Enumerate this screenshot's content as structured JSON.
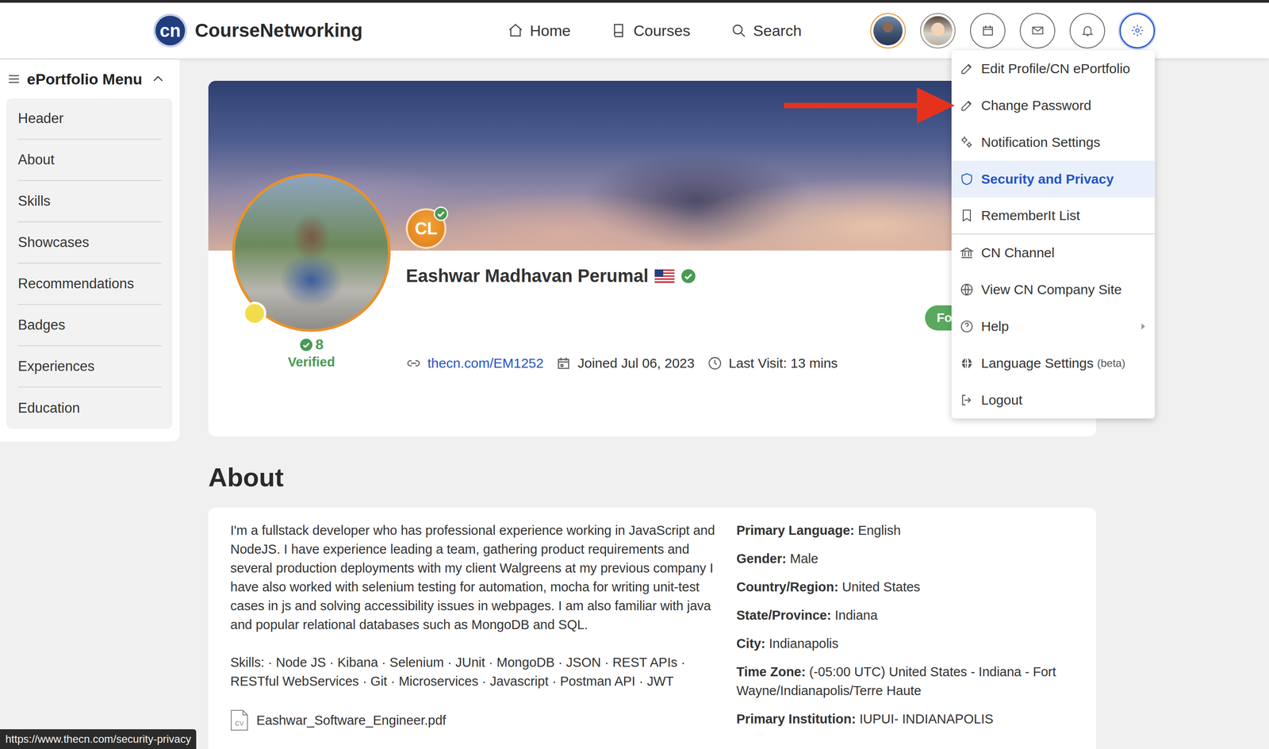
{
  "logo": {
    "mark": "cn",
    "name": "CourseNetworking"
  },
  "nav": [
    {
      "label": "Home",
      "selected": false
    },
    {
      "label": "Courses",
      "selected": false
    },
    {
      "label": "Search",
      "selected": false
    }
  ],
  "toolbar": [
    {
      "kind": "avatar",
      "selected": false,
      "color": "#e8912d"
    },
    {
      "kind": "avatar",
      "selected": false,
      "color": "#8a8a8a"
    },
    {
      "kind": "icon",
      "selected": false,
      "color": "#6b6b6b"
    },
    {
      "kind": "icon",
      "selected": false,
      "color": "#6b6b6b"
    },
    {
      "kind": "icon",
      "selected": false,
      "color": "#6b6b6b"
    },
    {
      "kind": "icon",
      "selected": true,
      "color": "#2d5bd1"
    }
  ],
  "sidebar": {
    "title": "ePortfolio Menu",
    "expanded": true,
    "items": [
      {
        "label": "Header",
        "selected": false
      },
      {
        "label": "About",
        "selected": false
      },
      {
        "label": "Skills",
        "selected": false
      },
      {
        "label": "Showcases",
        "selected": false
      },
      {
        "label": "Recommendations",
        "selected": false
      },
      {
        "label": "Badges",
        "selected": false
      },
      {
        "label": "Experiences",
        "selected": false
      },
      {
        "label": "Education",
        "selected": false
      }
    ]
  },
  "profile": {
    "name": "Eashwar Madhavan Perumal",
    "verified": true,
    "online": true,
    "badge": "CL",
    "badge_verified": true,
    "verified_count": "8",
    "verified_label": "Verified",
    "link": "thecn.com/EM1252",
    "joined": "Joined Jul 06, 2023",
    "last_visit": "Last Visit: 13 mins",
    "follow_button": "Fo"
  },
  "about": {
    "heading": "About",
    "bio": "I'm a fullstack developer who has professional experience working in JavaScript and NodeJS. I have experience leading a team, gathering product requirements and several production deployments with my client Walgreens at my previous company I have also worked with selenium testing for automation, mocha for writing unit-test cases in js and solving accessibility issues in webpages. I am also familiar with java and popular relational databases such as MongoDB and SQL.",
    "skills": "Skills: · Node JS · Kibana · Selenium · JUnit · MongoDB · JSON · REST APIs · RESTful WebServices · Git · Microservices · Javascript · Postman API · JWT",
    "resume": "Eashwar_Software_Engineer.pdf",
    "resume_icon": "CV",
    "details": [
      {
        "label": "Primary Language:",
        "value": "English"
      },
      {
        "label": "Gender:",
        "value": "Male"
      },
      {
        "label": "Country/Region:",
        "value": "United States"
      },
      {
        "label": "State/Province:",
        "value": "Indiana"
      },
      {
        "label": "City:",
        "value": "Indianapolis"
      },
      {
        "label": "Time Zone:",
        "value": "(-05:00 UTC) United States - Indiana - Fort Wayne/Indianapolis/Terre Haute"
      },
      {
        "label": "Primary Institution:",
        "value": "IUPUI- INDIANAPOLIS"
      }
    ]
  },
  "menu": {
    "open": true,
    "items": [
      {
        "label": "Edit Profile/CN ePortfolio",
        "note": "",
        "selected": false,
        "annotated": false,
        "submenu": false,
        "separator_after": false
      },
      {
        "label": "Change Password",
        "note": "",
        "selected": false,
        "annotated": true,
        "submenu": false,
        "separator_after": false
      },
      {
        "label": "Notification Settings",
        "note": "",
        "selected": false,
        "annotated": false,
        "submenu": false,
        "separator_after": false
      },
      {
        "label": "Security and Privacy",
        "note": "",
        "selected": true,
        "annotated": false,
        "submenu": false,
        "separator_after": false
      },
      {
        "label": "RememberIt List",
        "note": "",
        "selected": false,
        "annotated": false,
        "submenu": false,
        "separator_after": true
      },
      {
        "label": "CN Channel",
        "note": "",
        "selected": false,
        "annotated": false,
        "submenu": false,
        "separator_after": false
      },
      {
        "label": "View CN Company Site",
        "note": "",
        "selected": false,
        "annotated": false,
        "submenu": false,
        "separator_after": false
      },
      {
        "label": "Help",
        "note": "",
        "selected": false,
        "annotated": false,
        "submenu": true,
        "separator_after": false
      },
      {
        "label": "Language Settings",
        "note": "(beta)",
        "selected": false,
        "annotated": false,
        "submenu": false,
        "separator_after": false
      },
      {
        "label": "Logout",
        "note": "",
        "selected": false,
        "annotated": false,
        "submenu": false,
        "separator_after": false
      }
    ]
  },
  "status_url": "https://www.thecn.com/security-privacy"
}
